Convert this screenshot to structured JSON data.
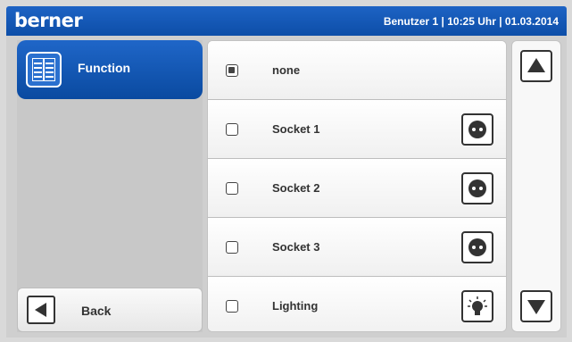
{
  "header": {
    "brand": "berner",
    "status": "Benutzer 1 | 10:25 Uhr | 01.03.2014"
  },
  "sidebar": {
    "function_label": "Function",
    "back_label": "Back"
  },
  "list": {
    "items": [
      {
        "label": "none",
        "checked": true,
        "icon": null
      },
      {
        "label": "Socket 1",
        "checked": false,
        "icon": "socket-icon"
      },
      {
        "label": "Socket 2",
        "checked": false,
        "icon": "socket-icon"
      },
      {
        "label": "Socket 3",
        "checked": false,
        "icon": "socket-icon"
      },
      {
        "label": "Lighting",
        "checked": false,
        "icon": "light-bulb-icon"
      }
    ]
  },
  "scroll": {
    "up_icon": "arrow-up-icon",
    "down_icon": "arrow-down-icon"
  },
  "colors": {
    "accent": "#0d4ea8",
    "background": "#cfcfcf"
  }
}
